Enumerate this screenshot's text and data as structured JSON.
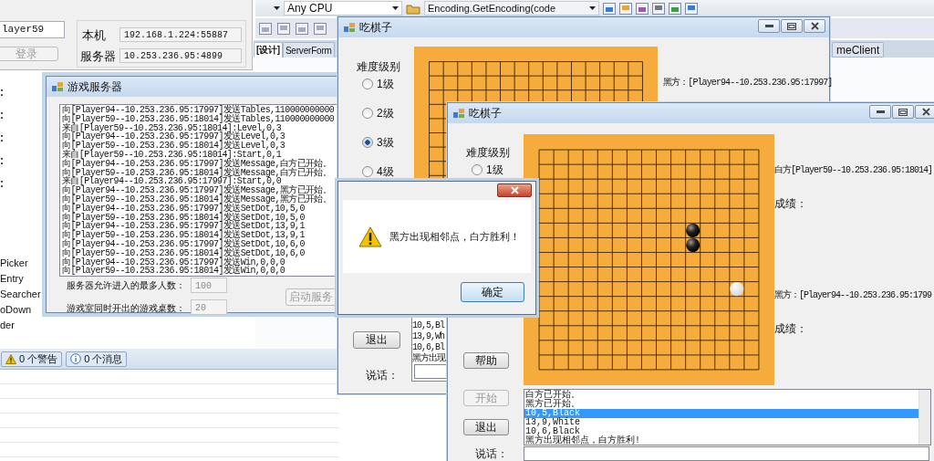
{
  "ide": {
    "name_field": "layer59",
    "login_button": {
      "label": "登录",
      "disabled": true
    },
    "local_label": "本机",
    "local_address": "192.168.1.224:55887",
    "server_label": "服务器",
    "server_address": "10.253.236.95:4899",
    "platform": "Any CPU",
    "code_context": "Encoding.GetEncoding(code",
    "document_tabs": [
      {
        "label": "[设计]",
        "selected": true
      },
      {
        "label": "ServerForm",
        "selected": false
      }
    ],
    "side_tab": "meClient",
    "property_labels": [
      ":",
      ":",
      ":",
      ":",
      ":"
    ],
    "toolbox_items": [
      "Picker",
      "Entry",
      "Searcher",
      "oDown",
      "der"
    ],
    "error_list_filters": [
      {
        "kind": "warning",
        "label": "0 个警告"
      },
      {
        "kind": "info",
        "label": "0 个消息"
      }
    ]
  },
  "server_window": {
    "title": "游戏服务器",
    "log": [
      "向[Player94--10.253.236.95:17997]发送Tables,110000000000",
      "向[Player59--10.253.236.95:18014]发送Tables,110000000000",
      "来自[Player59--10.253.236.95:18014]:Level,0,3",
      "向[Player94--10.253.236.95:17997]发送Level,0,3",
      "向[Player59--10.253.236.95:18014]发送Level,0,3",
      "来自[Player59--10.253.236.95:18014]:Start,0,1",
      "向[Player94--10.253.236.95:17997]发送Message,白方已开始。",
      "向[Player59--10.253.236.95:18014]发送Message,白方已开始。",
      "来自[Player94--10.253.236.95:17997]:Start,0,0",
      "向[Player94--10.253.236.95:17997]发送Message,黑方已开始。",
      "向[Player59--10.253.236.95:18014]发送Message,黑方已开始。",
      "向[Player94--10.253.236.95:17997]发送SetDot,10,5,0",
      "向[Player59--10.253.236.95:18014]发送SetDot,10,5,0",
      "向[Player94--10.253.236.95:17997]发送SetDot,13,9,1",
      "向[Player59--10.253.236.95:18014]发送SetDot,13,9,1",
      "向[Player94--10.253.236.95:17997]发送SetDot,10,6,0",
      "向[Player59--10.253.236.95:18014]发送SetDot,10,6,0",
      "向[Player94--10.253.236.95:17997]发送Win,0,0,0",
      "向[Player59--10.253.236.95:18014]发送Win,0,0,0"
    ],
    "max_players_label": "服务器允许进入的最多人数：",
    "max_players": "100",
    "tables_label": "游戏室同时开出的游戏桌数：",
    "tables": "20",
    "start_button": {
      "label": "启动服务",
      "disabled": true
    }
  },
  "game_window_back": {
    "title": "吃棋子",
    "level_title": "难度级别",
    "levels": [
      {
        "label": "1级",
        "selected": false
      },
      {
        "label": "2级",
        "selected": false
      },
      {
        "label": "3级",
        "selected": true
      },
      {
        "label": "4级",
        "selected": false
      }
    ],
    "player": "黑方：[Player94--10.253.236.95:17997]",
    "log": [
      "10,5,Bl",
      "13,9,Wh",
      "10,6,Bl",
      "黑方出现"
    ],
    "exit_button": "退出",
    "chat_label": "说话："
  },
  "game_window_front": {
    "title": "吃棋子",
    "level_title": "难度级别",
    "levels": [
      {
        "label": "1级",
        "selected": false
      }
    ],
    "board_rows": [
      [
        {
          "kind": "empty"
        },
        {
          "kind": "empty"
        },
        {
          "kind": "empty"
        },
        {
          "kind": "empty"
        },
        {
          "kind": "empty"
        },
        {
          "kind": "empty"
        },
        {
          "kind": "empty"
        },
        {
          "kind": "empty"
        },
        {
          "kind": "empty"
        },
        {
          "kind": "empty"
        },
        {
          "kind": "empty"
        },
        {
          "kind": "empty"
        },
        {
          "kind": "empty"
        },
        {
          "kind": "empty"
        },
        {
          "kind": "empty"
        }
      ],
      [
        {
          "kind": "empty"
        },
        {
          "kind": "empty"
        },
        {
          "kind": "empty"
        },
        {
          "kind": "empty"
        },
        {
          "kind": "empty"
        },
        {
          "kind": "empty"
        },
        {
          "kind": "empty"
        },
        {
          "kind": "empty"
        },
        {
          "kind": "empty"
        },
        {
          "kind": "empty"
        },
        {
          "kind": "empty"
        },
        {
          "kind": "empty"
        },
        {
          "kind": "empty"
        },
        {
          "kind": "empty"
        },
        {
          "kind": "empty"
        }
      ],
      [
        {
          "kind": "empty"
        },
        {
          "kind": "empty"
        },
        {
          "kind": "empty"
        },
        {
          "kind": "empty"
        },
        {
          "kind": "empty"
        },
        {
          "kind": "empty"
        },
        {
          "kind": "empty"
        },
        {
          "kind": "empty"
        },
        {
          "kind": "empty"
        },
        {
          "kind": "empty"
        },
        {
          "kind": "empty"
        },
        {
          "kind": "empty"
        },
        {
          "kind": "empty"
        },
        {
          "kind": "empty"
        },
        {
          "kind": "empty"
        }
      ],
      [
        {
          "kind": "empty"
        },
        {
          "kind": "empty"
        },
        {
          "kind": "empty"
        },
        {
          "kind": "empty"
        },
        {
          "kind": "empty"
        },
        {
          "kind": "empty"
        },
        {
          "kind": "empty"
        },
        {
          "kind": "empty"
        },
        {
          "kind": "empty"
        },
        {
          "kind": "empty"
        },
        {
          "kind": "empty"
        },
        {
          "kind": "empty"
        },
        {
          "kind": "empty"
        },
        {
          "kind": "empty"
        },
        {
          "kind": "empty"
        }
      ],
      [
        {
          "kind": "empty"
        },
        {
          "kind": "empty"
        },
        {
          "kind": "empty"
        },
        {
          "kind": "empty"
        },
        {
          "kind": "empty"
        },
        {
          "kind": "empty"
        },
        {
          "kind": "empty"
        },
        {
          "kind": "empty"
        },
        {
          "kind": "empty"
        },
        {
          "kind": "empty"
        },
        {
          "kind": "empty"
        },
        {
          "kind": "empty"
        },
        {
          "kind": "empty"
        },
        {
          "kind": "empty"
        },
        {
          "kind": "empty"
        }
      ],
      [
        {
          "kind": "empty"
        },
        {
          "kind": "empty"
        },
        {
          "kind": "empty"
        },
        {
          "kind": "empty"
        },
        {
          "kind": "empty"
        },
        {
          "kind": "empty"
        },
        {
          "kind": "empty"
        },
        {
          "kind": "empty"
        },
        {
          "kind": "empty"
        },
        {
          "kind": "empty"
        },
        {
          "kind": "black"
        },
        {
          "kind": "empty"
        },
        {
          "kind": "empty"
        },
        {
          "kind": "empty"
        },
        {
          "kind": "empty"
        }
      ],
      [
        {
          "kind": "empty"
        },
        {
          "kind": "empty"
        },
        {
          "kind": "empty"
        },
        {
          "kind": "empty"
        },
        {
          "kind": "empty"
        },
        {
          "kind": "empty"
        },
        {
          "kind": "empty"
        },
        {
          "kind": "empty"
        },
        {
          "kind": "empty"
        },
        {
          "kind": "empty"
        },
        {
          "kind": "black"
        },
        {
          "kind": "empty"
        },
        {
          "kind": "empty"
        },
        {
          "kind": "empty"
        },
        {
          "kind": "empty"
        }
      ],
      [
        {
          "kind": "empty"
        },
        {
          "kind": "empty"
        },
        {
          "kind": "empty"
        },
        {
          "kind": "empty"
        },
        {
          "kind": "empty"
        },
        {
          "kind": "empty"
        },
        {
          "kind": "empty"
        },
        {
          "kind": "empty"
        },
        {
          "kind": "empty"
        },
        {
          "kind": "empty"
        },
        {
          "kind": "empty"
        },
        {
          "kind": "empty"
        },
        {
          "kind": "empty"
        },
        {
          "kind": "empty"
        },
        {
          "kind": "empty"
        }
      ],
      [
        {
          "kind": "empty"
        },
        {
          "kind": "empty"
        },
        {
          "kind": "empty"
        },
        {
          "kind": "empty"
        },
        {
          "kind": "empty"
        },
        {
          "kind": "empty"
        },
        {
          "kind": "empty"
        },
        {
          "kind": "empty"
        },
        {
          "kind": "empty"
        },
        {
          "kind": "empty"
        },
        {
          "kind": "empty"
        },
        {
          "kind": "empty"
        },
        {
          "kind": "empty"
        },
        {
          "kind": "empty"
        },
        {
          "kind": "empty"
        }
      ],
      [
        {
          "kind": "empty"
        },
        {
          "kind": "empty"
        },
        {
          "kind": "empty"
        },
        {
          "kind": "empty"
        },
        {
          "kind": "empty"
        },
        {
          "kind": "empty"
        },
        {
          "kind": "empty"
        },
        {
          "kind": "empty"
        },
        {
          "kind": "empty"
        },
        {
          "kind": "empty"
        },
        {
          "kind": "empty"
        },
        {
          "kind": "empty"
        },
        {
          "kind": "empty"
        },
        {
          "kind": "white"
        },
        {
          "kind": "empty"
        }
      ],
      [
        {
          "kind": "empty"
        },
        {
          "kind": "empty"
        },
        {
          "kind": "empty"
        },
        {
          "kind": "empty"
        },
        {
          "kind": "empty"
        },
        {
          "kind": "empty"
        },
        {
          "kind": "empty"
        },
        {
          "kind": "empty"
        },
        {
          "kind": "empty"
        },
        {
          "kind": "empty"
        },
        {
          "kind": "empty"
        },
        {
          "kind": "empty"
        },
        {
          "kind": "empty"
        },
        {
          "kind": "empty"
        },
        {
          "kind": "empty"
        }
      ],
      [
        {
          "kind": "empty"
        },
        {
          "kind": "empty"
        },
        {
          "kind": "empty"
        },
        {
          "kind": "empty"
        },
        {
          "kind": "empty"
        },
        {
          "kind": "empty"
        },
        {
          "kind": "empty"
        },
        {
          "kind": "empty"
        },
        {
          "kind": "empty"
        },
        {
          "kind": "empty"
        },
        {
          "kind": "empty"
        },
        {
          "kind": "empty"
        },
        {
          "kind": "empty"
        },
        {
          "kind": "empty"
        },
        {
          "kind": "empty"
        }
      ],
      [
        {
          "kind": "empty"
        },
        {
          "kind": "empty"
        },
        {
          "kind": "empty"
        },
        {
          "kind": "empty"
        },
        {
          "kind": "empty"
        },
        {
          "kind": "empty"
        },
        {
          "kind": "empty"
        },
        {
          "kind": "empty"
        },
        {
          "kind": "empty"
        },
        {
          "kind": "empty"
        },
        {
          "kind": "empty"
        },
        {
          "kind": "empty"
        },
        {
          "kind": "empty"
        },
        {
          "kind": "empty"
        },
        {
          "kind": "empty"
        }
      ],
      [
        {
          "kind": "empty"
        },
        {
          "kind": "empty"
        },
        {
          "kind": "empty"
        },
        {
          "kind": "empty"
        },
        {
          "kind": "empty"
        },
        {
          "kind": "empty"
        },
        {
          "kind": "empty"
        },
        {
          "kind": "empty"
        },
        {
          "kind": "empty"
        },
        {
          "kind": "empty"
        },
        {
          "kind": "empty"
        },
        {
          "kind": "empty"
        },
        {
          "kind": "empty"
        },
        {
          "kind": "empty"
        },
        {
          "kind": "empty"
        }
      ],
      [
        {
          "kind": "empty"
        },
        {
          "kind": "empty"
        },
        {
          "kind": "empty"
        },
        {
          "kind": "empty"
        },
        {
          "kind": "empty"
        },
        {
          "kind": "empty"
        },
        {
          "kind": "empty"
        },
        {
          "kind": "empty"
        },
        {
          "kind": "empty"
        },
        {
          "kind": "empty"
        },
        {
          "kind": "empty"
        },
        {
          "kind": "empty"
        },
        {
          "kind": "empty"
        },
        {
          "kind": "empty"
        },
        {
          "kind": "empty"
        }
      ]
    ],
    "players": [
      {
        "name": "白方[Player59--10.253.236.95:18014]",
        "score_label": "成绩："
      },
      {
        "name": "黑方：[Player94--10.253.236.95:1799",
        "score_label": "成绩："
      }
    ],
    "buttons": [
      {
        "label": "帮助",
        "disabled": false
      },
      {
        "label": "开始",
        "disabled": true
      },
      {
        "label": "退出",
        "disabled": false
      }
    ],
    "log": [
      {
        "text": "白方已开始。",
        "selected": false
      },
      {
        "text": "黑方已开始。",
        "selected": false
      },
      {
        "text": "10,5,Black",
        "selected": true
      },
      {
        "text": "13,9,White",
        "selected": false
      },
      {
        "text": "10,6,Black",
        "selected": false
      },
      {
        "text": "黑方出现相邻点，白方胜利!",
        "selected": false
      }
    ],
    "chat_label": "说话："
  },
  "message_box": {
    "text": "黑方出现相邻点，白方胜利！",
    "ok_button": "确定"
  }
}
